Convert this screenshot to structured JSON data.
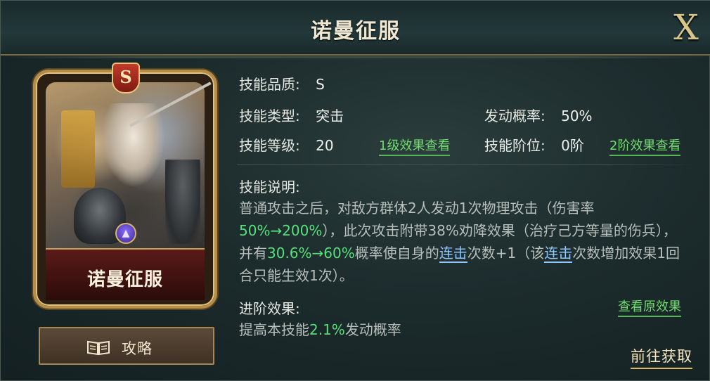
{
  "window": {
    "title": "诺曼征服",
    "close_label": "X"
  },
  "card": {
    "rank_badge": "S",
    "name": "诺曼征服"
  },
  "guide_button": {
    "label": "攻略",
    "icon": "book-icon"
  },
  "info": {
    "quality_label": "技能品质:",
    "quality_value": "S",
    "type_label": "技能类型:",
    "type_value": "突击",
    "chance_label": "发动概率:",
    "chance_value": "50%",
    "level_label": "技能等级:",
    "level_value": "20",
    "level1_link": "1级效果查看",
    "tier_label": "技能阶位:",
    "tier_value": "0阶",
    "tier2_link": "2阶效果查看"
  },
  "description": {
    "title": "技能说明:",
    "p1": "普通攻击之后，对敌方群体2人发动1次物理攻击（伤害率",
    "h1": "50%→200%",
    "p2": "），此次攻击附带38%劝降效果（治疗己方等量的伤兵），并有",
    "h2": "30.6%→60%",
    "p3": "概率使自身的",
    "kw1": "连击",
    "p4": "次数+1（该",
    "kw2": "连击",
    "p5": "次数增加效果1回合只能生效1次）。"
  },
  "advanced": {
    "title": "进阶效果:",
    "view_original_link": "查看原效果",
    "p1": "提高本技能",
    "h1": "2.1%",
    "p2": "发动概率"
  },
  "go_button": {
    "label": "前往获取"
  }
}
